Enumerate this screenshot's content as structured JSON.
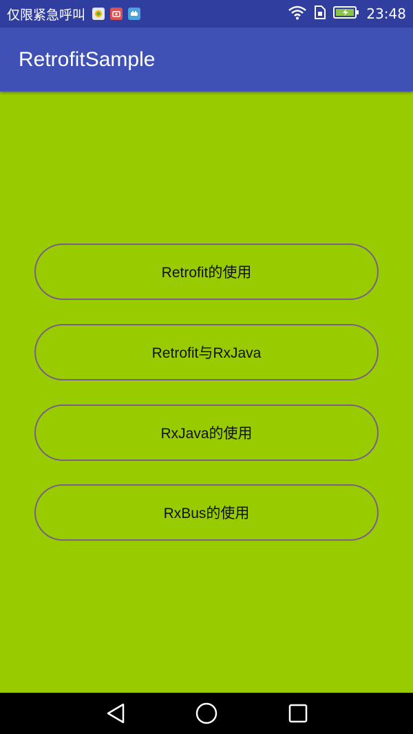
{
  "status_bar": {
    "carrier": "仅限紧急呼叫",
    "time": "23:48",
    "icons": [
      "app-notification-icon",
      "recorder-notification-icon",
      "game-notification-icon",
      "wifi-icon",
      "sim-icon",
      "battery-charging-icon"
    ],
    "colors": {
      "background": "#303f9f"
    }
  },
  "app_bar": {
    "title": "RetrofitSample",
    "colors": {
      "background": "#3f51b5",
      "text": "#ffffff"
    }
  },
  "main": {
    "background": "#99cc00",
    "buttons": [
      {
        "label": "Retrofit的使用"
      },
      {
        "label": "Retrofit与RxJava"
      },
      {
        "label": "RxJava的使用"
      },
      {
        "label": "RxBus的使用"
      }
    ],
    "button_border_color": "#7a5d8c"
  },
  "nav_bar": {
    "icons": [
      "back-icon",
      "home-icon",
      "recents-icon"
    ]
  }
}
